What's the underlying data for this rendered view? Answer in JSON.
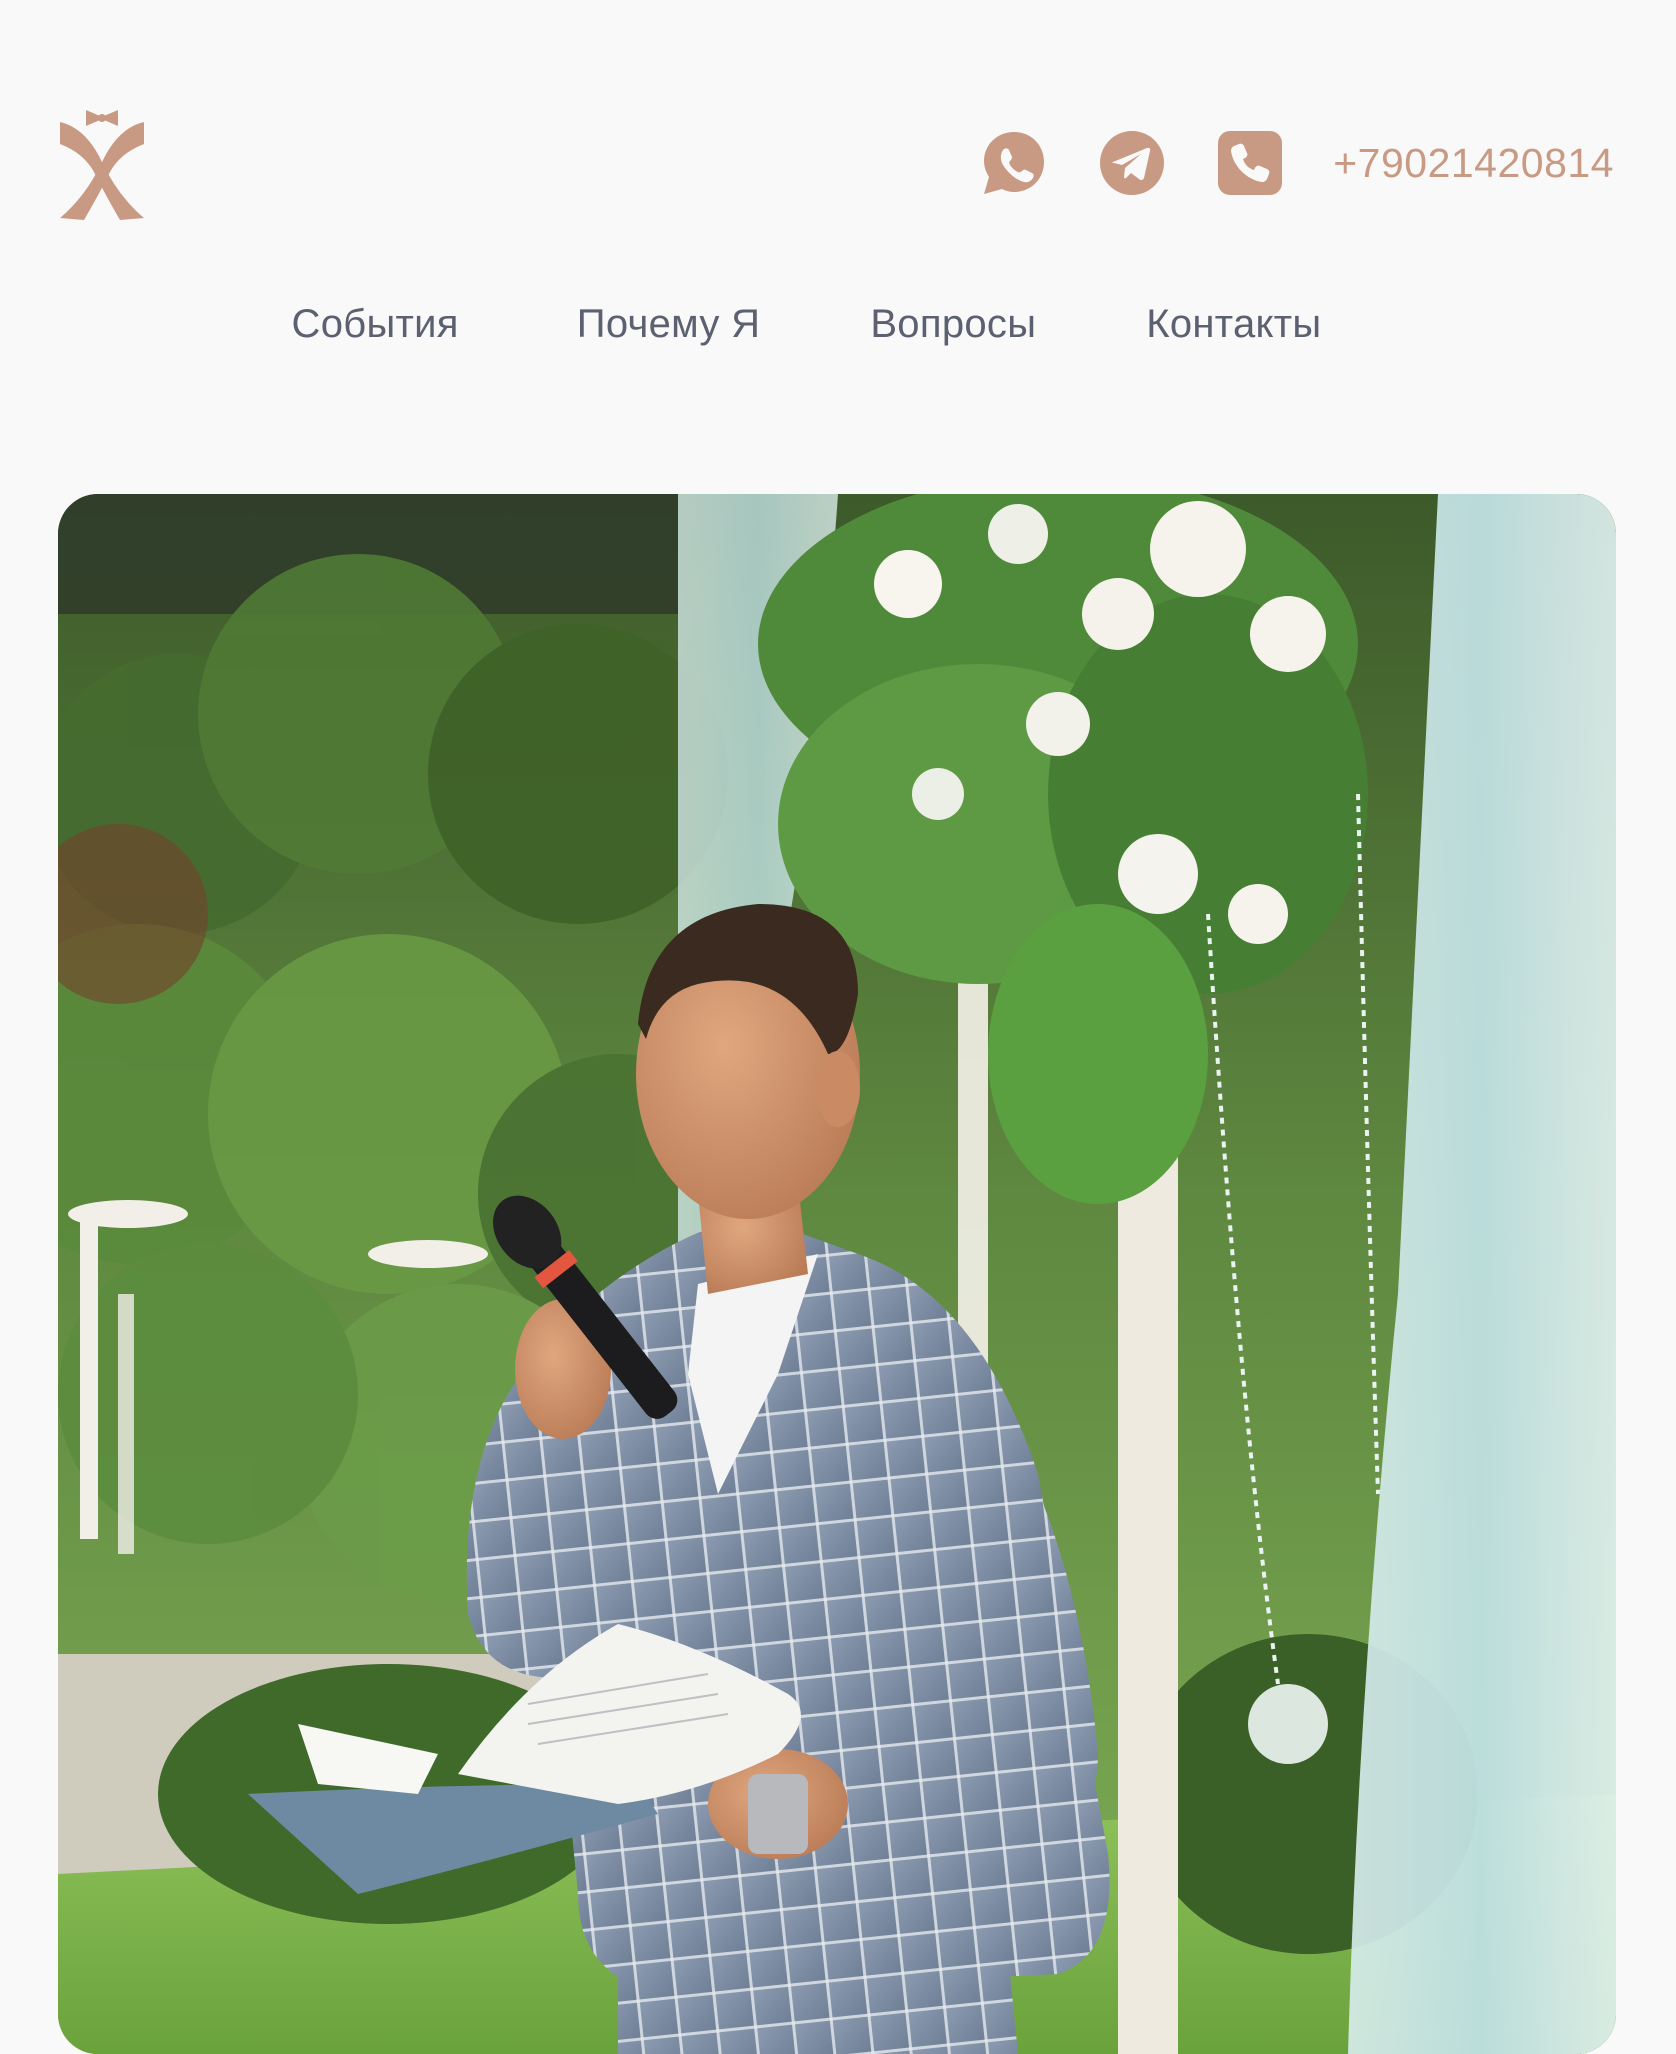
{
  "header": {
    "logo_name": "bowtie-x-logo",
    "brand_color": "#c99a83",
    "contacts": {
      "whatsapp_icon": "whatsapp-icon",
      "telegram_icon": "telegram-icon",
      "phone_icon": "phone-icon",
      "phone_number": "+79021420814"
    }
  },
  "nav": {
    "items": [
      {
        "label": "События"
      },
      {
        "label": "Почему Я"
      },
      {
        "label": "Вопросы"
      },
      {
        "label": "Контакты"
      }
    ]
  },
  "hero": {
    "image_subject": "host-speaking-at-wedding-ceremony-photo"
  }
}
